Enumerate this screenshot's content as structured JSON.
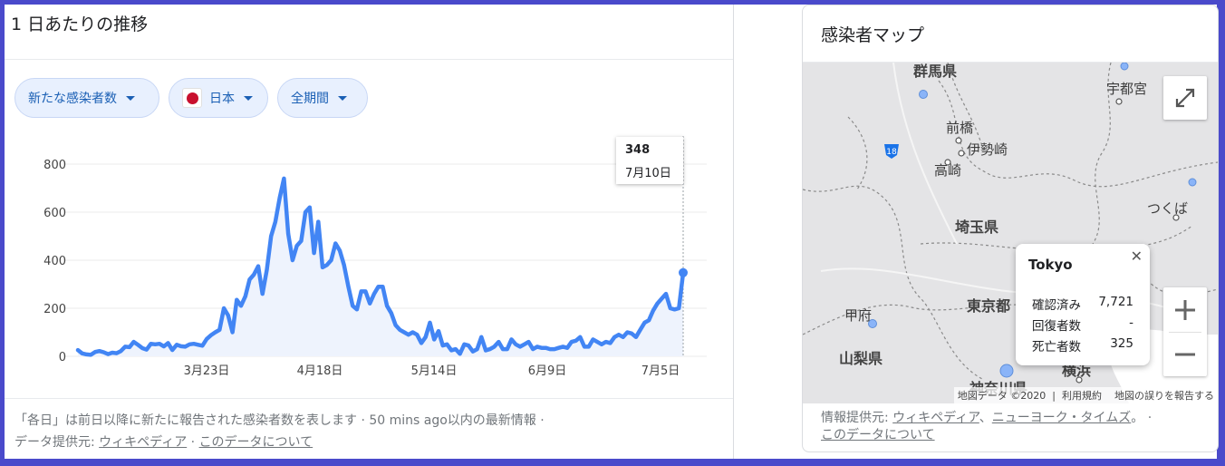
{
  "left": {
    "title": "1 日あたりの推移",
    "chips": [
      {
        "label": "新たな感染者数"
      },
      {
        "label": "日本"
      },
      {
        "label": "全期間"
      }
    ],
    "tooltip": {
      "value": "348",
      "date": "7月10日"
    },
    "footer": {
      "text1": "「各日」は前日以降に新たに報告された感染者数を表します · 50 mins ago以内の最新情報 ·",
      "source_prefix": "データ提供元:",
      "source_link": "ウィキペディア",
      "sep": "·",
      "about_link": "このデータについて"
    }
  },
  "chart_data": {
    "type": "line",
    "title": "",
    "xlabel": "",
    "ylabel": "",
    "ylim": [
      0,
      800
    ],
    "yticks": [
      "800",
      "600",
      "400",
      "200",
      "0"
    ],
    "xticks": [
      "3月23日",
      "4月18日",
      "5月14日",
      "6月9日",
      "7月5日"
    ],
    "color": "#4285f4",
    "series": [
      {
        "values": [
          26,
          12,
          8,
          6,
          18,
          22,
          17,
          9,
          15,
          13,
          22,
          40,
          38,
          60,
          48,
          34,
          28,
          52,
          50,
          52,
          41,
          55,
          26,
          48,
          42,
          40,
          50,
          52,
          48,
          44,
          72,
          88,
          100,
          110,
          200,
          170,
          100,
          235,
          210,
          250,
          320,
          340,
          375,
          260,
          360,
          500,
          560,
          660,
          740,
          510,
          400,
          460,
          480,
          600,
          620,
          430,
          560,
          370,
          380,
          400,
          470,
          440,
          380,
          290,
          210,
          195,
          270,
          270,
          220,
          260,
          290,
          290,
          210,
          180,
          130,
          110,
          100,
          90,
          100,
          90,
          55,
          80,
          140,
          70,
          105,
          45,
          50,
          25,
          30,
          10,
          50,
          45,
          20,
          30,
          80,
          25,
          30,
          40,
          60,
          30,
          30,
          70,
          50,
          40,
          50,
          60,
          30,
          40,
          35,
          35,
          30,
          30,
          35,
          40,
          35,
          60,
          65,
          80,
          40,
          40,
          70,
          60,
          50,
          60,
          55,
          80,
          90,
          80,
          100,
          95,
          80,
          110,
          140,
          150,
          190,
          220,
          240,
          260,
          200,
          195,
          200,
          348
        ]
      }
    ]
  },
  "right": {
    "title": "感染者マップ",
    "map_labels": {
      "gunma": "群馬県",
      "utsunomiya": "宇都宮",
      "maebashi": "前橋",
      "isesaki": "伊勢崎",
      "takasaki": "高崎",
      "tsukuba": "つくば",
      "saitama": "埼玉県",
      "tokyo": "東京都",
      "tokyo_city": "東京",
      "kofu": "甲府",
      "yamanashi": "山梨県",
      "yokohama": "横浜",
      "kanagawa": "神奈川県",
      "route": "18"
    },
    "popup": {
      "name": "Tokyo",
      "rows": [
        {
          "label": "確認済み",
          "value": "7,721"
        },
        {
          "label": "回復者数",
          "value": "-"
        },
        {
          "label": "死亡者数",
          "value": "325"
        }
      ]
    },
    "attribution": {
      "data": "地図データ ©2020",
      "terms": "利用規約",
      "report": "地図の誤りを報告する"
    },
    "footer": {
      "prefix": "情報提供元:",
      "link1": "ウィキペディア",
      "sep1": "、",
      "link2": "ニューヨーク・タイムズ",
      "end": "。",
      "dot": "·",
      "about_link": "このデータについて"
    }
  }
}
